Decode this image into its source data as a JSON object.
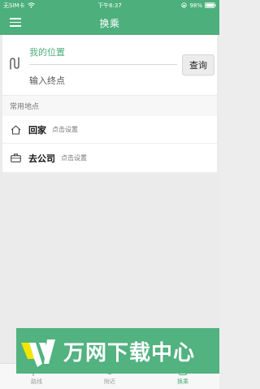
{
  "status_bar": {
    "carrier": "无SIM卡",
    "time": "下午6:37",
    "battery": "98%"
  },
  "nav": {
    "title": "换乘",
    "menu_icon": "menu-icon"
  },
  "route": {
    "origin_value": "我的位置",
    "destination_placeholder": "输入终点",
    "query_label": "查询",
    "swap_icon": "route-swap-icon"
  },
  "common_places": {
    "header": "常用地点",
    "items": [
      {
        "name": "回家",
        "hint": "点击设置",
        "icon": "home-icon"
      },
      {
        "name": "去公司",
        "hint": "点击设置",
        "icon": "briefcase-icon"
      }
    ]
  },
  "tabs": [
    {
      "label": "路线",
      "icon": "route-icon"
    },
    {
      "label": "附近",
      "icon": "nearby-icon"
    },
    {
      "label": "换乘",
      "icon": "transfer-icon"
    }
  ],
  "watermark": {
    "text": "万网下载中心"
  },
  "colors": {
    "accent": "#4caf7c",
    "background": "#ebebeb"
  }
}
